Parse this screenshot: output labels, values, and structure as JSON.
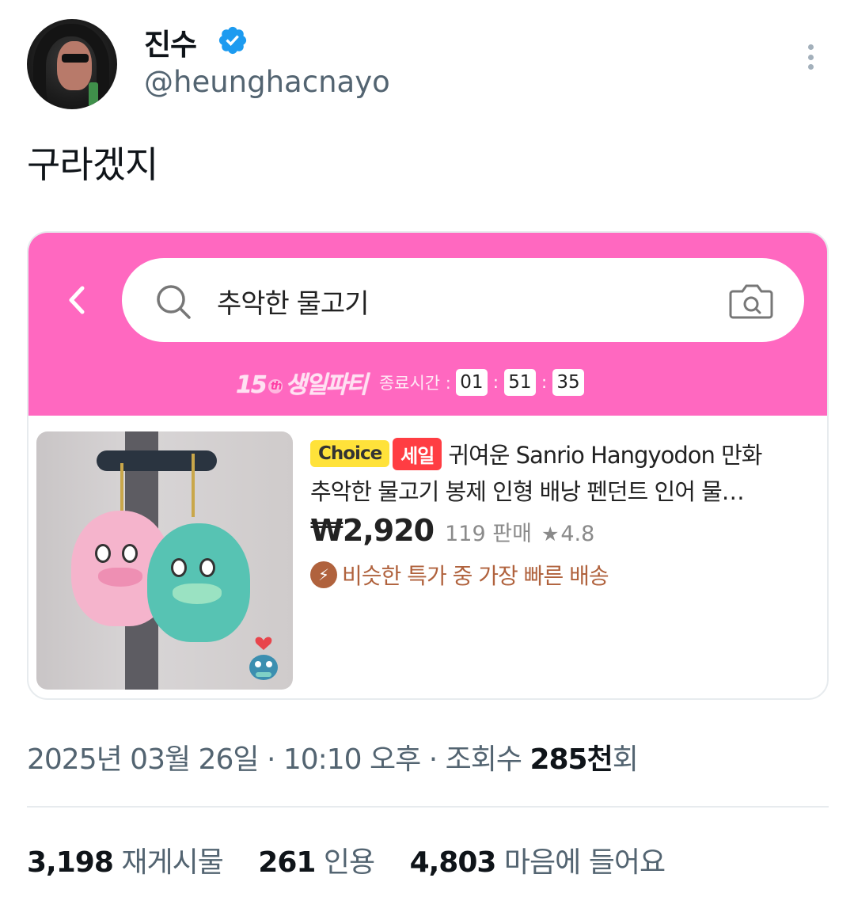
{
  "author": {
    "display_name": "진수",
    "handle": "@heunghacnayo",
    "verified": true,
    "verified_color": "#1d9bf0"
  },
  "tweet": {
    "text": "구라겠지"
  },
  "card": {
    "header_color": "#ff68c0",
    "search": {
      "query": "추악한 물고기",
      "icons": [
        "back-chevron-icon",
        "search-icon",
        "camera-icon"
      ]
    },
    "promo": {
      "badge_number": "15",
      "badge_sup": "th",
      "badge_text": "생일파티",
      "timer_label": "종료시간 :",
      "hours": "01",
      "minutes": "51",
      "seconds": "35"
    },
    "product": {
      "tag_choice": "Choice",
      "tag_sale": "세일",
      "title_line1": "귀여운 Sanrio Hangyodon 만화",
      "title_line2": "추악한 물고기 봉제 인형 배낭 펜던트 인어 물…",
      "price": "₩2,920",
      "sold": "119 판매",
      "rating": "4.8",
      "delivery": "비슷한 특가 중 가장 빠른 배송"
    }
  },
  "meta": {
    "date": "2025년 03월 26일",
    "time": "10:10 오후",
    "views_label": "조회수",
    "views_count": "285천",
    "views_suffix": "회"
  },
  "stats": {
    "retweets": "3,198",
    "retweets_label": "재게시물",
    "quotes": "261",
    "quotes_label": "인용",
    "likes": "4,803",
    "likes_label": "마음에 들어요"
  }
}
